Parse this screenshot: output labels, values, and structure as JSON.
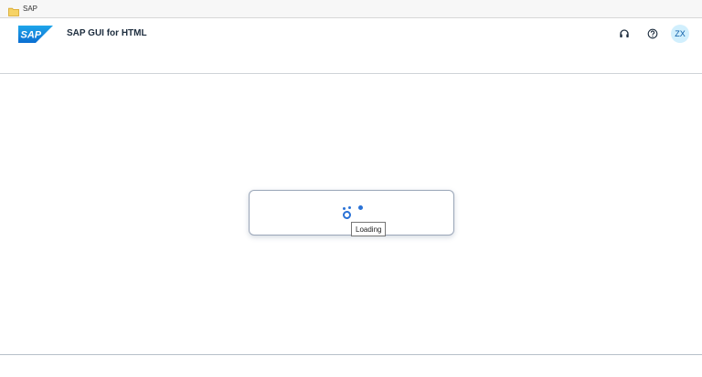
{
  "browser": {
    "bookmarks": [
      {
        "label": "SAP",
        "icon": "folder-icon"
      }
    ]
  },
  "shell": {
    "logo_text": "SAP",
    "title": "SAP GUI for HTML",
    "actions": [
      {
        "name": "support-button",
        "icon": "headset-icon"
      },
      {
        "name": "help-button",
        "icon": "help-circle-icon"
      }
    ],
    "user_initials": "ZX"
  },
  "busy": {
    "tooltip": "Loading"
  },
  "colors": {
    "sap_blue": "#0a6ed1",
    "indicator_blue": "#2a72d6",
    "avatar_bg": "#d1effd",
    "avatar_text": "#0a5ba6",
    "folder_yellow": "#f2c94c"
  }
}
